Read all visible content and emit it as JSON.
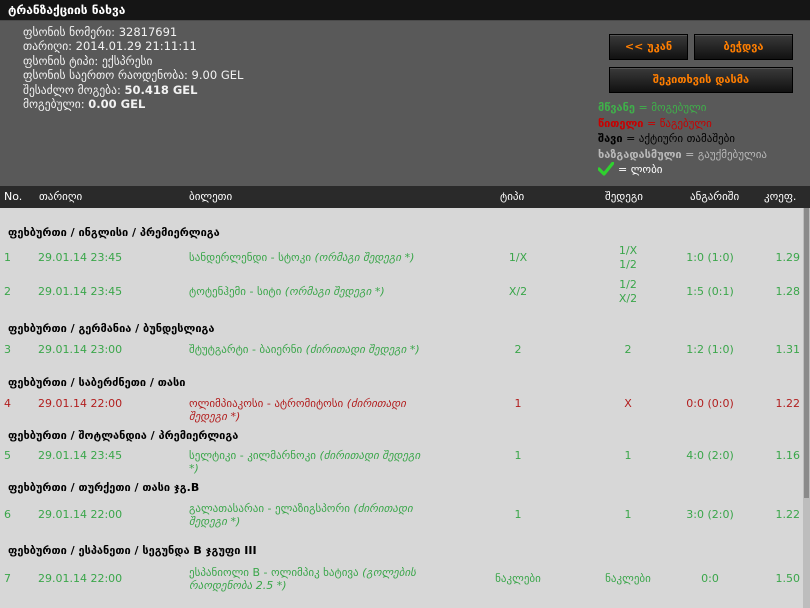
{
  "title": "ტრანზაქციის ნახვა",
  "info": {
    "slip_no": "ფსონის ნომერი: 32817691",
    "date": "თარიღი: 2014.01.29 21:11:11",
    "type": "ფსონის ტიპი: ექსპრესი",
    "total": "ფსონის საერთო რაოდენობა: 9.00 GEL",
    "possible_win_label": "შესაძლო მოგება: ",
    "possible_win_value": "50.418 GEL",
    "won_label": "მოგებული: ",
    "won_value": "0.00 GEL"
  },
  "buttons": {
    "back": "<< უკან",
    "print": "ბეჭდვა",
    "repeat": "შეკითხვის დასმა"
  },
  "legend": {
    "green_word": "მწვანე",
    "green_rest": " = მოგებული",
    "red_word": "წითელი",
    "red_rest": " = წაგებული",
    "black_word": "შავი",
    "black_rest": " = აქტიური თამაშები",
    "gray_word": "ხაზგადასმული",
    "gray_rest": " = გაუქმებულია",
    "check_rest": "= ლობი"
  },
  "columns": {
    "no": "No.",
    "date": "თარიღი",
    "match": "ბილეთი",
    "type": "ტიპი",
    "result": "შედეგი",
    "score": "ანგარიში",
    "odds": "კოეფ."
  },
  "sections": [
    {
      "title": "ფეხბურთი / ინგლისი / პრემიერლიგა",
      "rows": [
        {
          "no": "1",
          "date": "29.01.14 23:45",
          "match": "სანდერლენდი - სტოკი ",
          "match_note": "(ორმაგი შედეგი *)",
          "type": "1/X",
          "result_1": "1/X",
          "result_2": "1/2",
          "score": "1:0 (1:0)",
          "odds": "1.29",
          "status": "green"
        },
        {
          "no": "2",
          "date": "29.01.14 23:45",
          "match": "ტოტენჰემი - სიტი ",
          "match_note": "(ორმაგი შედეგი *)",
          "type": "X/2",
          "result_1": "1/2",
          "result_2": "X/2",
          "score": "1:5 (0:1)",
          "odds": "1.28",
          "status": "green"
        }
      ]
    },
    {
      "title": "ფეხბურთი / გერმანია / ბუნდესლიგა",
      "rows": [
        {
          "no": "3",
          "date": "29.01.14 23:00",
          "match": "შტუტგარტი - ბაიერნი ",
          "match_note": "(ძირითადი შედეგი *)",
          "type": "2",
          "result_1": "2",
          "result_2": "",
          "score": "1:2 (1:0)",
          "odds": "1.31",
          "status": "green"
        }
      ]
    },
    {
      "title": "ფეხბურთი / საბერძნეთი / თასი",
      "rows": [
        {
          "no": "4",
          "date": "29.01.14 22:00",
          "match": "ოლიმპიაკოსი - ატრომიტოსი ",
          "match_note": "(ძირითადი შედეგი *)",
          "type": "1",
          "result_1": "X",
          "result_2": "",
          "score": "0:0 (0:0)",
          "odds": "1.22",
          "status": "red"
        }
      ]
    },
    {
      "title": "ფეხბურთი / შოტლანდია / პრემიერლიგა",
      "rows": [
        {
          "no": "5",
          "date": "29.01.14 23:45",
          "match": "სელტიკი - კილმარნოკი ",
          "match_note": "(ძირითადი შედეგი *)",
          "type": "1",
          "result_1": "1",
          "result_2": "",
          "score": "4:0 (2:0)",
          "odds": "1.16",
          "status": "green"
        }
      ]
    },
    {
      "title": "ფეხბურთი / თურქეთი / თასი ჯგ.B",
      "rows": [
        {
          "no": "6",
          "date": "29.01.14 22:00",
          "match": "გალათასარაი - ელაზიგსპორი ",
          "match_note": "(ძირითადი შედეგი *)",
          "type": "1",
          "result_1": "1",
          "result_2": "",
          "score": "3:0 (2:0)",
          "odds": "1.22",
          "status": "green"
        }
      ]
    },
    {
      "title": "ფეხბურთი / ესპანეთი / სეგუნდა B ჯგუფი III",
      "rows": [
        {
          "no": "7",
          "date": "29.01.14 22:00",
          "match": "ესპანიოლი B - ოლიმპიკ ხატივა ",
          "match_note": "(გოლების რაოდენობა 2.5 *)",
          "type": "ნაკლები",
          "result_1": "ნაკლები",
          "result_2": "",
          "score": "0:0",
          "odds": "1.50",
          "status": "green"
        }
      ]
    }
  ]
}
